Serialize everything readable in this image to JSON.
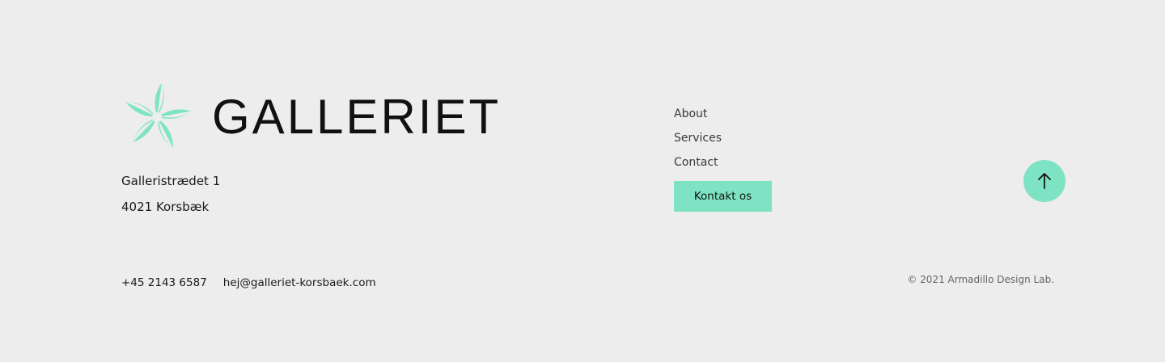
{
  "colors": {
    "accent": "#7de3c3",
    "background": "#ededed",
    "text": "#1a1a1a"
  },
  "brand": {
    "logo_icon": "flower-icon",
    "name": "GALLERIET"
  },
  "address": {
    "street": "Galleristrædet 1",
    "city": "4021 Korsbæk"
  },
  "contact": {
    "phone": "+45 2143 6587",
    "email": "hej@galleriet-korsbaek.com"
  },
  "nav": {
    "items": [
      {
        "label": "About"
      },
      {
        "label": "Services"
      },
      {
        "label": "Contact"
      }
    ],
    "cta_label": "Kontakt os"
  },
  "scroll_top": {
    "icon": "arrow-up-icon"
  },
  "copyright": "© 2021 Armadillo Design Lab."
}
